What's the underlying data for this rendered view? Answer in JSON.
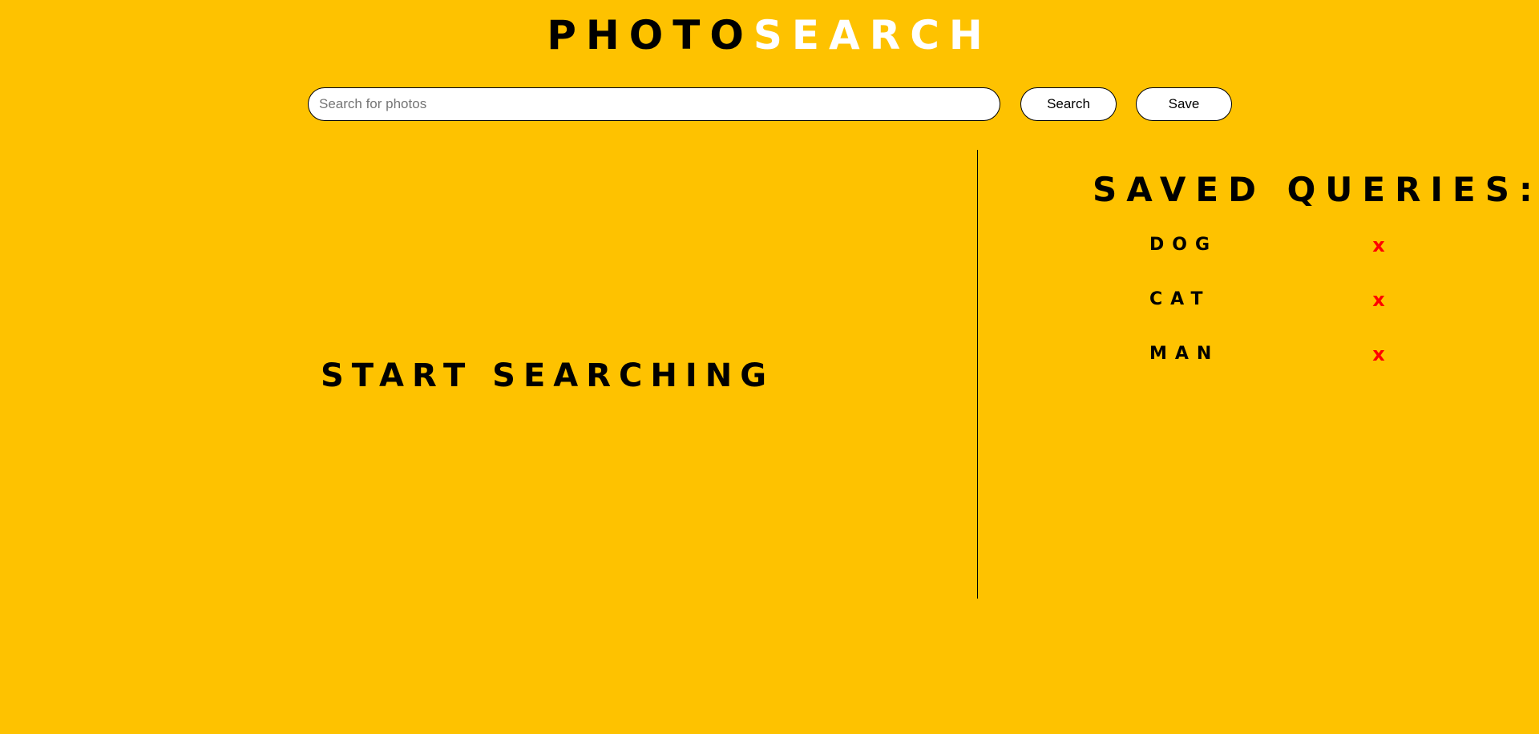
{
  "header": {
    "logo_primary": "Photo",
    "logo_accent": "Search"
  },
  "search": {
    "placeholder": "Search for photos",
    "value": "",
    "search_label": "Search",
    "save_label": "Save"
  },
  "results": {
    "empty_message": "Start Searching"
  },
  "saved": {
    "title": "Saved Queries:",
    "queries": [
      {
        "label": "Dog",
        "delete_label": "x"
      },
      {
        "label": "Cat",
        "delete_label": "x"
      },
      {
        "label": "Man",
        "delete_label": "x"
      }
    ]
  },
  "colors": {
    "background": "#FEC200",
    "logo_accent": "#FFFFFF",
    "delete": "#FF0000",
    "text": "#000000"
  }
}
